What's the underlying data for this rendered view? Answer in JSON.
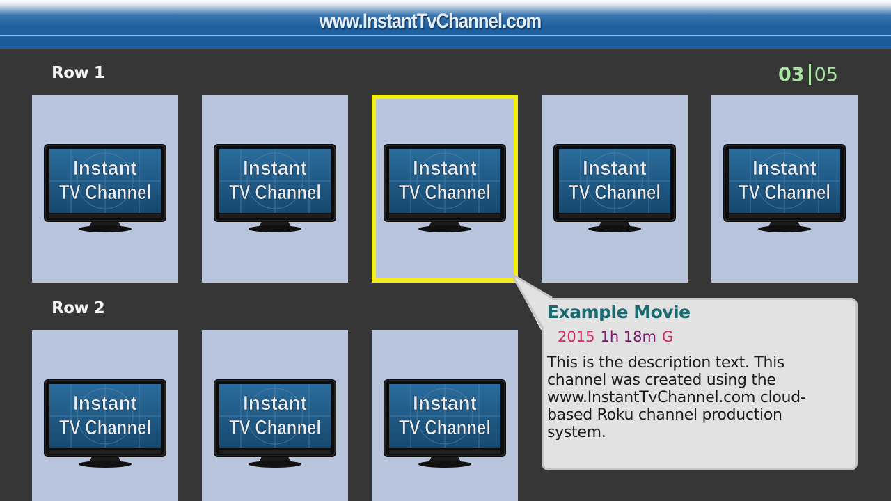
{
  "header": {
    "title": "www.InstantTvChannel.com"
  },
  "rows": [
    {
      "label": "Row 1"
    },
    {
      "label": "Row 2"
    }
  ],
  "counter": {
    "current": "03",
    "total": "05"
  },
  "poster": {
    "line1": "Instant",
    "line2": "TV Channel"
  },
  "selected": {
    "title": "Example Movie",
    "year": "2015",
    "runtime": "1h 18m",
    "rating": "G",
    "description": "This is the description text. This channel was created using the www.InstantTvChannel.com cloud-based Roku channel production system."
  },
  "colors": {
    "background": "#363636",
    "tile": "#b8c4dc",
    "focus_border": "#f2ec19",
    "counter": "#a8e5a0",
    "title": "#1a6a6f",
    "accent_pink": "#d62566",
    "accent_purple": "#7b1a6b"
  }
}
